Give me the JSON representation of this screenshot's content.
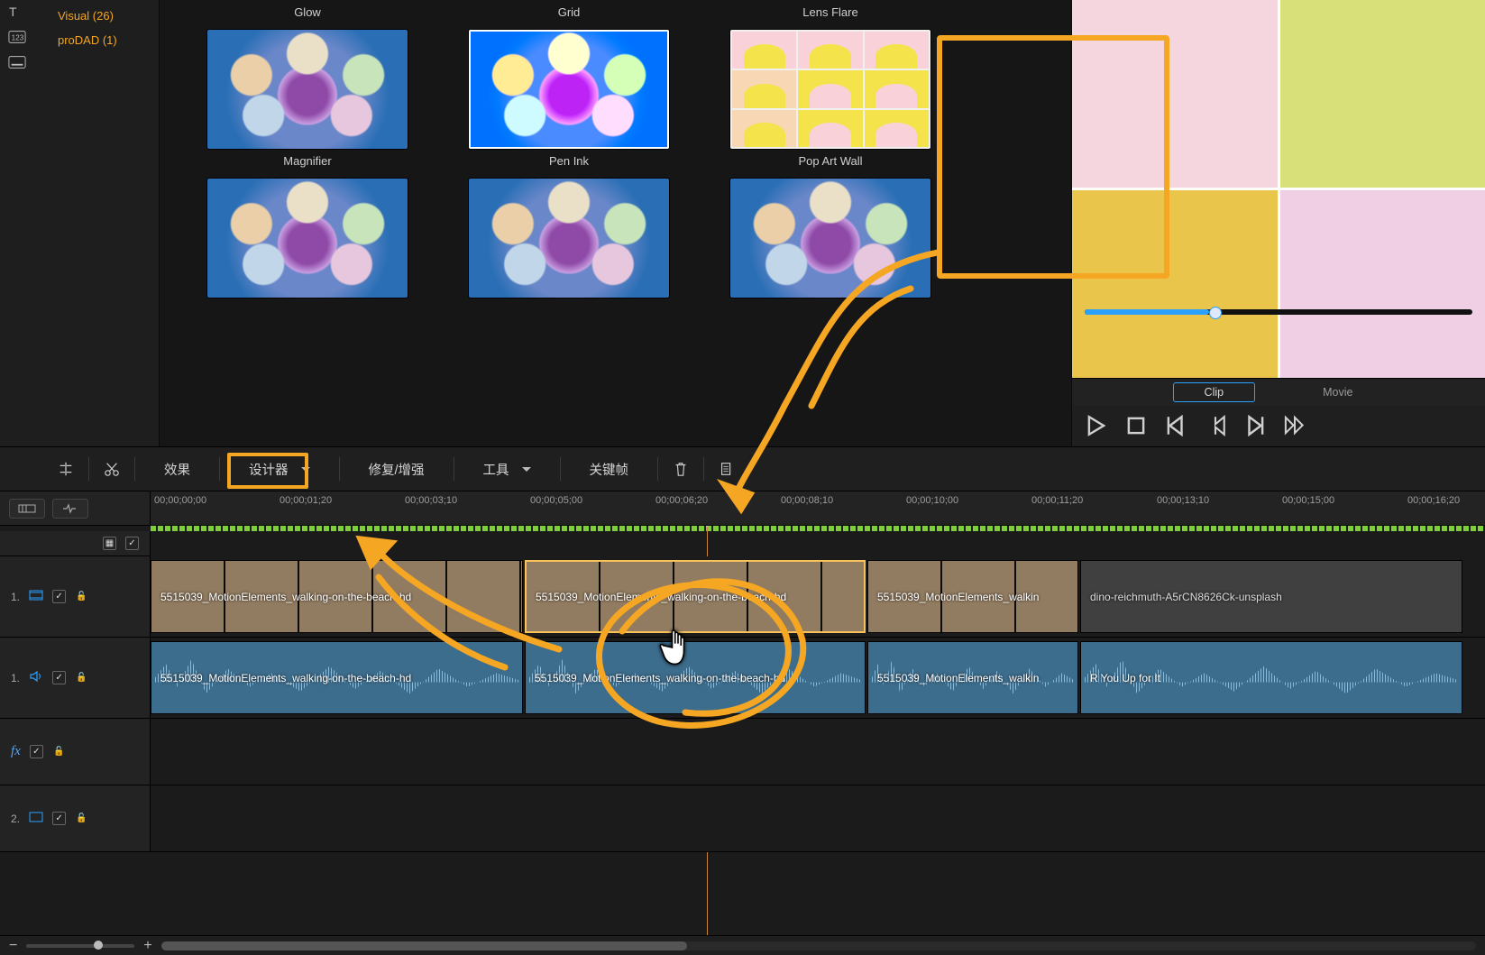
{
  "sidebar": {
    "items": [
      {
        "label": "Visual  (26)"
      },
      {
        "label": "proDAD  (1)"
      }
    ]
  },
  "effects": {
    "row1": [
      "Glow",
      "Grid",
      "Lens Flare"
    ],
    "row2": [
      "Magnifier",
      "Pen Ink",
      "Pop Art Wall"
    ],
    "row3": [
      "",
      "",
      ""
    ]
  },
  "preview": {
    "tab_clip": "Clip",
    "tab_movie": "Movie"
  },
  "toolbar": {
    "effects": "效果",
    "designer": "设计器",
    "fix": "修复/增强",
    "keyframes": "关键帧"
  },
  "ruler": [
    "00;00;00;00",
    "00;00;01;20",
    "00;00;03;10",
    "00;00;05;00",
    "00;00;06;20",
    "00;00;08;10",
    "00;00;10;00",
    "00;00;11;20",
    "00;00;13;10",
    "00;00;15;00",
    "00;00;16;20"
  ],
  "tracks": {
    "video1_label": "1.",
    "audio1_label": "1.",
    "fx_label": "",
    "video2_label": "2.",
    "clip_a": "5515039_MotionElements_walking-on-the-beach-hd",
    "clip_b": "5515039_MotionElements_walking-on-the-beach-hd",
    "clip_c": "5515039_MotionElements_walkin",
    "clip_d": "dino-reichmuth-A5rCN8626Ck-unsplash",
    "aclip_a": "5515039_MotionElements_walking-on-the-beach-hd",
    "aclip_b": "5515039_MotionElements_walking-on-the-beach-hd",
    "aclip_c": "5515039_MotionElements_walkin",
    "aclip_d": "R You Up for It"
  }
}
